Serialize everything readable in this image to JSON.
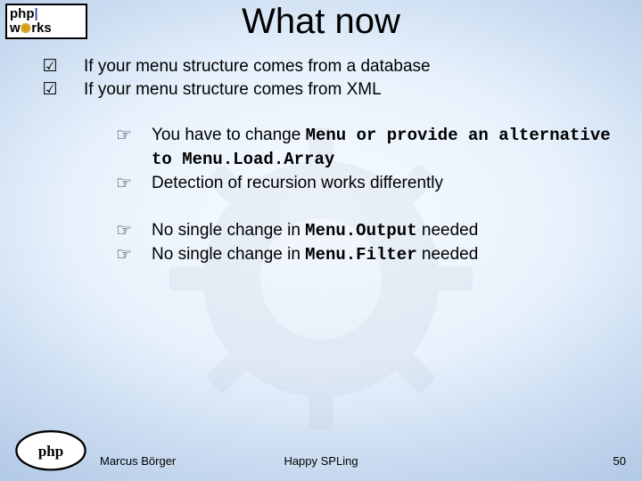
{
  "logo": {
    "line1a": "php",
    "line1b": "|",
    "line2a": "w",
    "line2b": "rks"
  },
  "title": "What now",
  "icons": {
    "check": "☑",
    "hand": "☞"
  },
  "bullets": [
    "If your menu structure comes from a database",
    "If your menu structure comes from XML"
  ],
  "sub": {
    "0": {
      "a": "You have to change ",
      "b": "Menu ",
      "c": "or provide an alternative to ",
      "d": "Menu.Load.Array"
    },
    "1": "Detection of recursion works differently",
    "2": {
      "a": "No single change in ",
      "b": "Menu.Output",
      "c": " needed"
    },
    "3": {
      "a": "No single change in ",
      "b": "Menu.Filter",
      "c": " needed"
    }
  },
  "footer": {
    "author": "Marcus Börger",
    "center": "Happy SPLing",
    "page": "50"
  }
}
